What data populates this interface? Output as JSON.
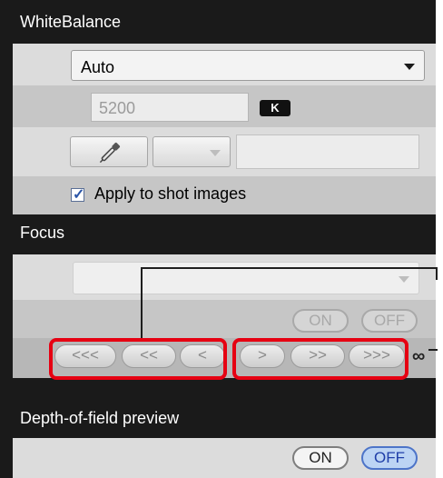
{
  "white_balance": {
    "title": "WhiteBalance",
    "mode_value": "Auto",
    "kelvin_value": "5200",
    "kelvin_unit": "K",
    "apply_label": "Apply to shot images",
    "apply_checked": true,
    "eyedropper_icon": "eyedropper-icon"
  },
  "focus": {
    "title": "Focus",
    "on_label": "ON",
    "off_label": "OFF",
    "buttons": [
      "<<<",
      "<<",
      "<",
      ">",
      ">>",
      ">>>"
    ],
    "infinity": "∞"
  },
  "dof": {
    "title": "Depth-of-field preview",
    "on_label": "ON",
    "off_label": "OFF",
    "selected": "OFF"
  },
  "colors": {
    "highlight": "#e60012",
    "selected_off": "#bcd4f4",
    "header_bg": "#1a1a1a"
  }
}
